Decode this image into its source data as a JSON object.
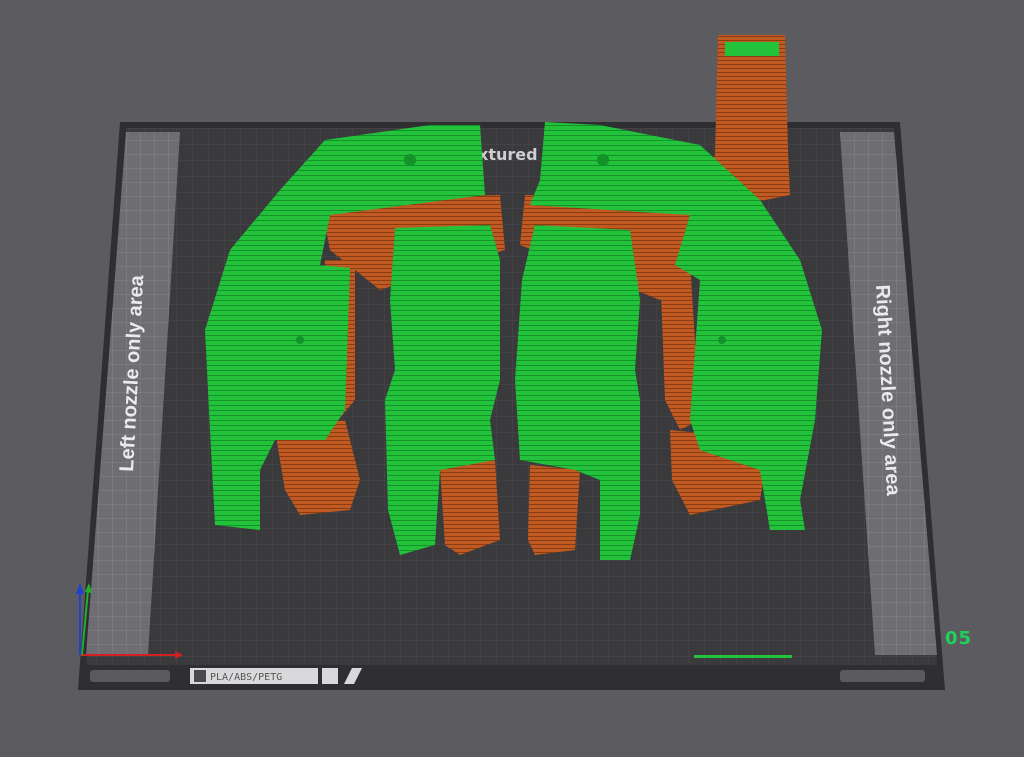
{
  "viewport": {
    "bed_logo_text": "xtured",
    "left_zone_label": "Left nozzle only area",
    "right_zone_label": "Right nozzle only area",
    "filament_badge": "PLA/ABS/PETG",
    "plate_number": "05"
  },
  "colors": {
    "background": "#5b5b60",
    "bed": "#3a3a3d",
    "bed_zone": "#6e6e72",
    "green_filament": "#22c23a",
    "orange_filament": "#c05a22",
    "plate_number": "#1fd15a",
    "axis_x": "#d02020",
    "axis_y": "#20b030",
    "axis_z": "#2040d0"
  },
  "icons": [
    "axis-gizmo-icon",
    "bed-corner-icon"
  ]
}
